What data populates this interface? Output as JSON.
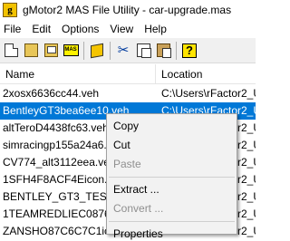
{
  "window": {
    "title": "gMotor2 MAS File Utility - car-upgrade.mas",
    "icon": "app-g-icon",
    "icon_letter": "g"
  },
  "menu": [
    "File",
    "Edit",
    "Options",
    "View",
    "Help"
  ],
  "toolbar": {
    "icons": [
      "new-file-icon",
      "open-folder-icon",
      "open-image-icon",
      "mas-archive-icon",
      "cube-icon",
      "scissors-icon",
      "copy-icon",
      "paste-icon",
      "help-icon"
    ],
    "mas_label": "MAS"
  },
  "list": {
    "columns": [
      "Name",
      "Location"
    ],
    "rows": [
      {
        "name": "2xosx6636cc44.veh",
        "location": "C:\\Users\\rFactor2_U"
      },
      {
        "name": "BentleyGT3bea6ee10.veh",
        "location": "C:\\Users\\rFactor2_U",
        "selected": true
      },
      {
        "name": "altTeroD4438fc63.veh",
        "location": "C:\\Users\\rFactor2_U"
      },
      {
        "name": "simracingp155a24a6.ve",
        "location": "C:\\Users\\rFactor2_U"
      },
      {
        "name": "CV774_alt3112eea.veh",
        "location": "C:\\Users\\rFactor2_U"
      },
      {
        "name": "1SFH4F8ACF4Eicon.pr",
        "location": "C:\\Users\\rFactor2_U"
      },
      {
        "name": "BENTLEY_GT3_TESTicc",
        "location": "C:\\Users\\rFactor2_U"
      },
      {
        "name": "1TEAMREDLIEC0876C",
        "location": "C:\\Users\\rFactor2_U"
      },
      {
        "name": "ZANSHO87C6C7C1icc",
        "location": "C:\\Users\\rFactor2_U"
      }
    ]
  },
  "context_menu": {
    "copy": "Copy",
    "cut": "Cut",
    "paste": "Paste",
    "extract": "Extract ...",
    "convert": "Convert ...",
    "properties": "Properties"
  },
  "colors": {
    "selection": "#0078d7",
    "disabled_text": "#8f8f8f"
  }
}
